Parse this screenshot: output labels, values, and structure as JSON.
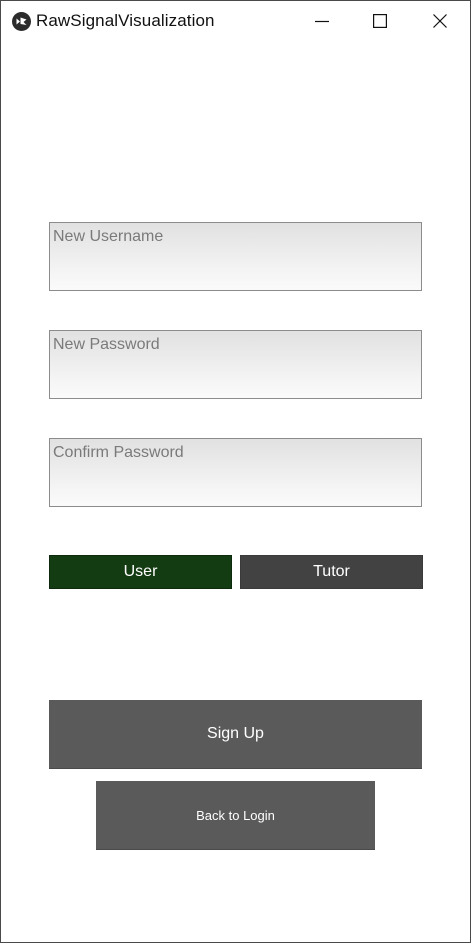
{
  "window": {
    "title": "RawSignalVisualization",
    "icon": "kivy-logo-icon",
    "controls": [
      "minimize-icon",
      "maximize-icon",
      "close-icon"
    ]
  },
  "form": {
    "username_placeholder": "New Username",
    "username_value": "",
    "password_placeholder": "New Password",
    "password_value": "",
    "confirm_placeholder": "Confirm Password",
    "confirm_value": ""
  },
  "roles": {
    "user_label": "User",
    "tutor_label": "Tutor",
    "selected": "User"
  },
  "actions": {
    "signup_label": "Sign Up",
    "back_label": "Back to Login"
  },
  "colors": {
    "selected_role": "#143c13",
    "unselected_role": "#424242",
    "action_button": "#5a5a5a"
  }
}
